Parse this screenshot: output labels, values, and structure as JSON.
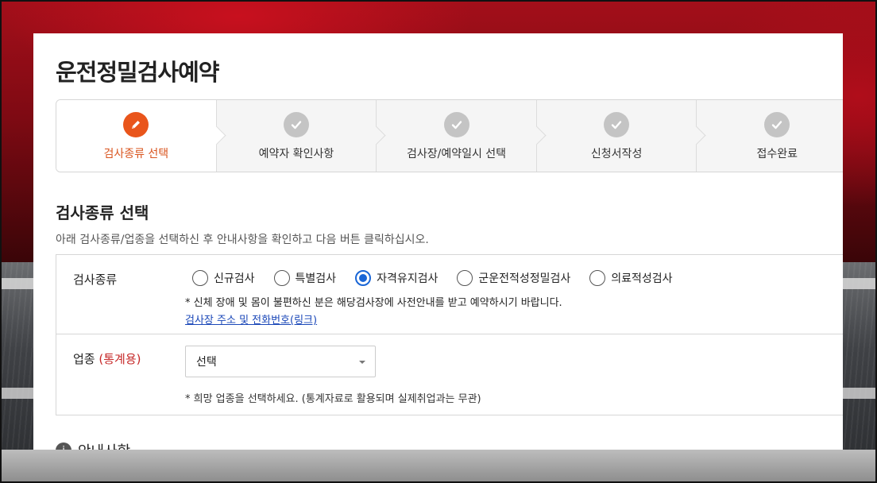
{
  "page": {
    "title": "운전정밀검사예약"
  },
  "steps": [
    {
      "label": "검사종류 선택",
      "icon": "pencil-icon",
      "active": true
    },
    {
      "label": "예약자 확인사항",
      "icon": "check-icon",
      "active": false
    },
    {
      "label": "검사장/예약일시 선택",
      "icon": "check-icon",
      "active": false
    },
    {
      "label": "신청서작성",
      "icon": "check-icon",
      "active": false
    },
    {
      "label": "접수완료",
      "icon": "check-icon",
      "active": false
    }
  ],
  "section": {
    "title": "검사종류 선택",
    "description": "아래 검사종류/업종을 선택하신 후 안내사항을 확인하고 다음 버튼 클릭하십시오."
  },
  "form": {
    "exam_type": {
      "label": "검사종류",
      "options": [
        "신규검사",
        "특별검사",
        "자격유지검사",
        "군운전적성정밀검사",
        "의료적성검사"
      ],
      "selected": "자격유지검사",
      "note": "* 신체 장애 및 몸이 불편하신 분은 해당검사장에 사전안내를 받고 예약하시기 바랍니다.",
      "link_text": "검사장 주소 및 전화번호(링크)"
    },
    "industry": {
      "label": "업종",
      "label_accent": "(통계용)",
      "selected_value": "선택",
      "note": "* 희망 업종을 선택하세요. (통계자료로 활용되며 실제취업과는 무관)"
    }
  },
  "info": {
    "heading": "안내사항",
    "icon": "info-icon"
  },
  "colors": {
    "accent": "#e9551b",
    "radio_checked": "#1a66d6",
    "link": "#1a47b8",
    "required": "#c62828"
  }
}
